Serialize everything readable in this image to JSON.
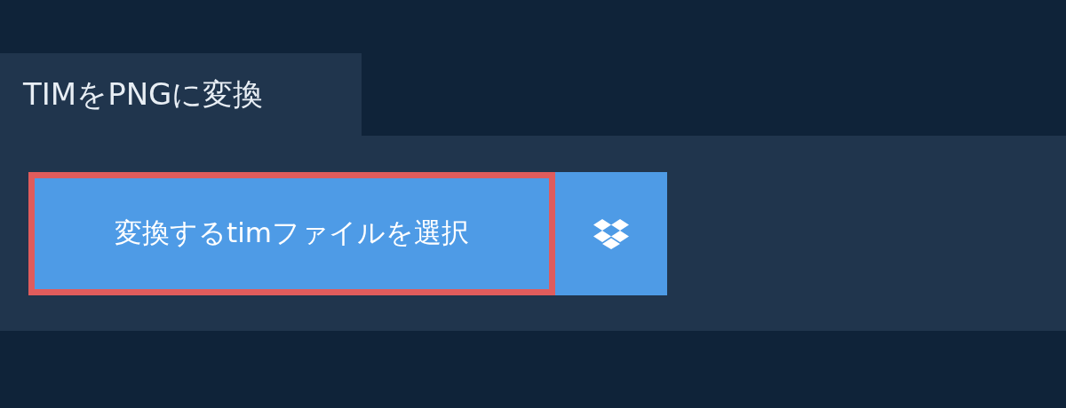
{
  "tab": {
    "label": "TIMをPNGに変換"
  },
  "buttons": {
    "choose_file": "変換するtimファイルを選択"
  }
}
